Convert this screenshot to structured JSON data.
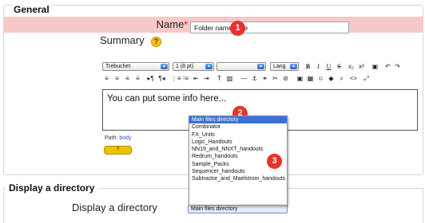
{
  "general": {
    "legend": "General",
    "name_label": "Name",
    "name_required_mark": "*",
    "name_value": "Folder name here",
    "summary_label": "Summary",
    "help_icon": "?"
  },
  "badges": {
    "one": "1",
    "two": "2",
    "three": "3"
  },
  "editor": {
    "font_select": "Trebuchet",
    "size_select": "1 (8 pt)",
    "format_select": "",
    "lang_select": "Lang",
    "buttons_row1": {
      "bold": "B",
      "italic": "I",
      "underline": "U",
      "strike": "S",
      "sub": "x₂",
      "sup": "x²",
      "paste": "▣",
      "undo": "↶",
      "redo": "↷"
    },
    "buttons_row2": {
      "align_left": "≡",
      "align_center": "≡",
      "align_right": "≡",
      "justify": "≡",
      "ltr": "▸¶",
      "rtl": "¶◂",
      "ol": "⋮≡",
      "ul": "⁝≡",
      "outdent": "⇤",
      "indent": "⇥",
      "forecolor": "T",
      "backcolor": "▨",
      "hr": "—",
      "anchor": "⚓",
      "link": "⚭",
      "unlink": "✂",
      "nolink": "⊘",
      "image": "▣",
      "table": "▦",
      "smiley": "☺",
      "insert": "◆",
      "search": "⌕",
      "code": "<>",
      "fullscreen": "⤢"
    },
    "content": "You can put some info here...",
    "path_label": "Path:",
    "path_value": "body",
    "help_badge": "?"
  },
  "display": {
    "legend": "Display a directory",
    "label": "Display a directory",
    "selected": "Main files directory",
    "options": [
      "Main files directory",
      "Combinator",
      "FX_Units",
      "Logic_Handouts",
      "NN19_and_NNXT_handouts",
      "Redrum_handouts",
      "Sample_Packs",
      "Sequencer_handouts",
      "Subtractor_and_Maelstrom_handouts"
    ]
  },
  "colors": {
    "required_row": "#f6c8c8",
    "badge": "#e8322b",
    "selection": "#3872d6"
  }
}
